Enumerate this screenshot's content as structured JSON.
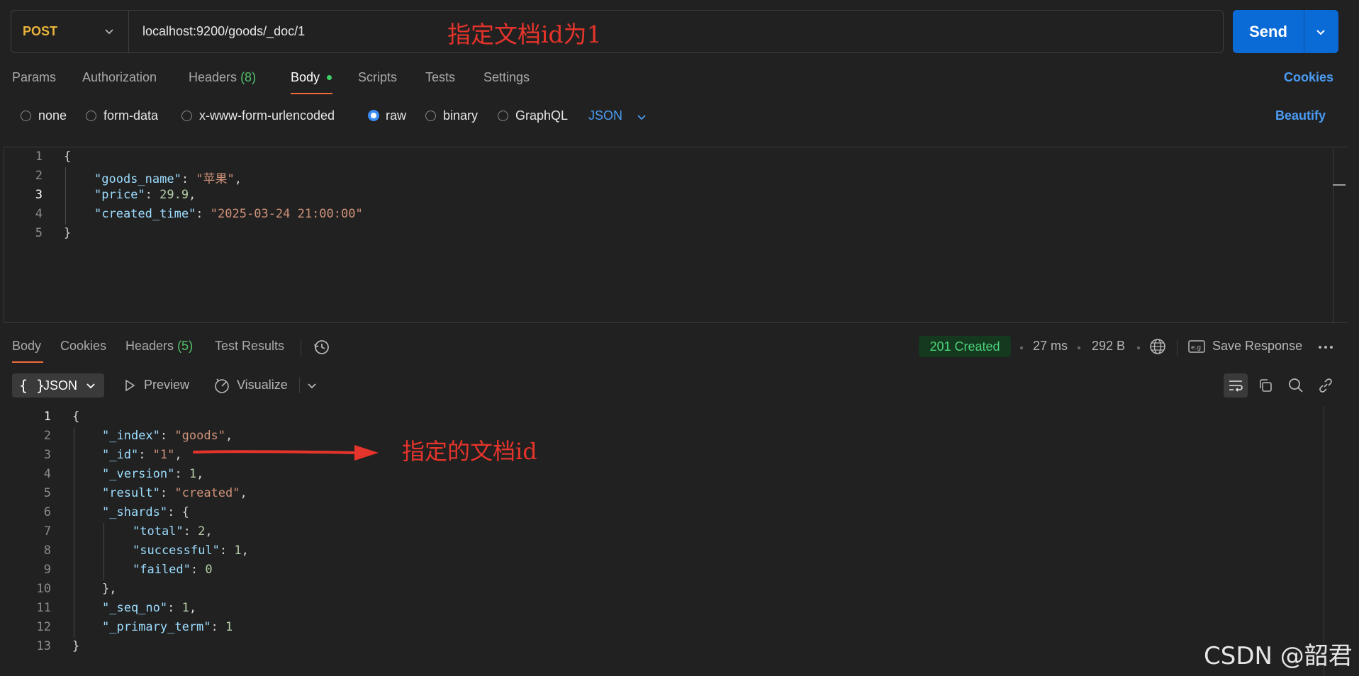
{
  "request": {
    "method": "POST",
    "url": "localhost:9200/goods/_doc/1",
    "send_label": "Send"
  },
  "annotations": {
    "url_note": "指定文档id为1",
    "id_note": "指定的文档id",
    "arrow_color": "#e5342b"
  },
  "request_tabs": {
    "params": "Params",
    "authorization": "Authorization",
    "headers": "Headers",
    "headers_count": "(8)",
    "body": "Body",
    "scripts": "Scripts",
    "tests": "Tests",
    "settings": "Settings",
    "cookies": "Cookies"
  },
  "body_options": {
    "none": "none",
    "form_data": "form-data",
    "urlencoded": "x-www-form-urlencoded",
    "raw": "raw",
    "binary": "binary",
    "graphql": "GraphQL",
    "language": "JSON",
    "beautify": "Beautify",
    "selected": "raw"
  },
  "request_body": {
    "line_numbers": [
      "1",
      "2",
      "3",
      "4",
      "5"
    ],
    "current_line": 3,
    "open_brace": "{",
    "close_brace": "}",
    "fields": [
      {
        "key": "\"goods_name\"",
        "value": "\"苹果\"",
        "value_type": "string",
        "trail": ","
      },
      {
        "key": "\"price\"",
        "value": "29.9",
        "value_type": "number",
        "trail": ","
      },
      {
        "key": "\"created_time\"",
        "value": "\"2025-03-24 21:00:00\"",
        "value_type": "string",
        "trail": ""
      }
    ]
  },
  "response_tabs": {
    "body": "Body",
    "cookies": "Cookies",
    "headers": "Headers",
    "headers_count": "(5)",
    "test_results": "Test Results"
  },
  "response_meta": {
    "status": "201 Created",
    "time": "27 ms",
    "size": "292 B",
    "save_response": "Save Response",
    "status_color": "#4cd07a"
  },
  "response_toolbar": {
    "format_icon": "{ }",
    "format": "JSON",
    "preview": "Preview",
    "visualize": "Visualize"
  },
  "response_body": {
    "line_numbers": [
      "1",
      "2",
      "3",
      "4",
      "5",
      "6",
      "7",
      "8",
      "9",
      "10",
      "11",
      "12",
      "13"
    ],
    "l1": "{",
    "index_key": "\"_index\"",
    "index_val": "\"goods\"",
    "id_key": "\"_id\"",
    "id_val": "\"1\"",
    "version_key": "\"_version\"",
    "version_val": "1",
    "result_key": "\"result\"",
    "result_val": "\"created\"",
    "shards_key": "\"_shards\"",
    "shards_open": "{",
    "total_key": "\"total\"",
    "total_val": "2",
    "successful_key": "\"successful\"",
    "successful_val": "1",
    "failed_key": "\"failed\"",
    "failed_val": "0",
    "shards_close": "},",
    "seq_key": "\"_seq_no\"",
    "seq_val": "1",
    "term_key": "\"_primary_term\"",
    "term_val": "1",
    "l13": "}"
  },
  "watermark": "CSDN @韶君",
  "icons": [
    "chevron-down-icon",
    "history-icon",
    "globe-icon",
    "save-response-icon",
    "more-icon",
    "braces-icon",
    "play-icon",
    "visualize-icon",
    "wrap-icon",
    "copy-icon",
    "search-icon",
    "link-icon"
  ]
}
